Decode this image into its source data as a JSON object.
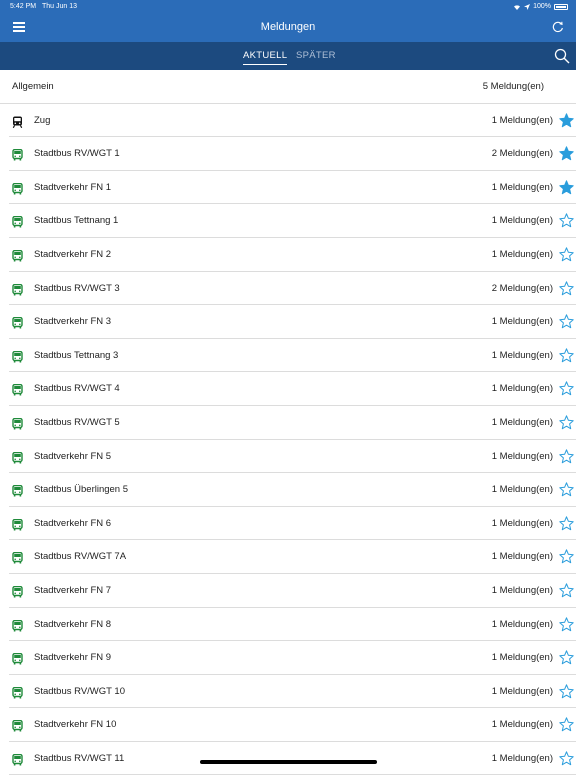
{
  "status_bar": {
    "time": "5:42 PM",
    "date": "Thu Jun 13",
    "battery": "100%"
  },
  "header": {
    "title": "Meldungen"
  },
  "tabs": [
    {
      "label": "AKTUELL",
      "active": true
    },
    {
      "label": "SPÄTER",
      "active": false
    }
  ],
  "general": {
    "label": "Allgemein",
    "count": "5 Meldung(en)"
  },
  "colors": {
    "nav": "#2b6cb8",
    "tabbar": "#1c4a7f",
    "bus": "#1f8a3a",
    "star": "#2a9ddc"
  },
  "items": [
    {
      "label": "Zug",
      "count": "1 Meldung(en)",
      "icon": "train-icon",
      "favorite": true
    },
    {
      "label": "Stadtbus RV/WGT 1",
      "count": "2 Meldung(en)",
      "icon": "bus-icon",
      "favorite": true
    },
    {
      "label": "Stadtverkehr FN 1",
      "count": "1 Meldung(en)",
      "icon": "bus-icon",
      "favorite": true
    },
    {
      "label": "Stadtbus Tettnang 1",
      "count": "1 Meldung(en)",
      "icon": "bus-icon",
      "favorite": false
    },
    {
      "label": "Stadtverkehr FN 2",
      "count": "1 Meldung(en)",
      "icon": "bus-icon",
      "favorite": false
    },
    {
      "label": "Stadtbus RV/WGT 3",
      "count": "2 Meldung(en)",
      "icon": "bus-icon",
      "favorite": false
    },
    {
      "label": "Stadtverkehr FN 3",
      "count": "1 Meldung(en)",
      "icon": "bus-icon",
      "favorite": false
    },
    {
      "label": "Stadtbus Tettnang 3",
      "count": "1 Meldung(en)",
      "icon": "bus-icon",
      "favorite": false
    },
    {
      "label": "Stadtbus RV/WGT 4",
      "count": "1 Meldung(en)",
      "icon": "bus-icon",
      "favorite": false
    },
    {
      "label": "Stadtbus RV/WGT 5",
      "count": "1 Meldung(en)",
      "icon": "bus-icon",
      "favorite": false
    },
    {
      "label": "Stadtverkehr FN 5",
      "count": "1 Meldung(en)",
      "icon": "bus-icon",
      "favorite": false
    },
    {
      "label": "Stadtbus Überlingen 5",
      "count": "1 Meldung(en)",
      "icon": "bus-icon",
      "favorite": false
    },
    {
      "label": "Stadtverkehr FN 6",
      "count": "1 Meldung(en)",
      "icon": "bus-icon",
      "favorite": false
    },
    {
      "label": "Stadtbus RV/WGT 7A",
      "count": "1 Meldung(en)",
      "icon": "bus-icon",
      "favorite": false
    },
    {
      "label": "Stadtverkehr FN 7",
      "count": "1 Meldung(en)",
      "icon": "bus-icon",
      "favorite": false
    },
    {
      "label": "Stadtverkehr FN 8",
      "count": "1 Meldung(en)",
      "icon": "bus-icon",
      "favorite": false
    },
    {
      "label": "Stadtverkehr FN 9",
      "count": "1 Meldung(en)",
      "icon": "bus-icon",
      "favorite": false
    },
    {
      "label": "Stadtbus RV/WGT 10",
      "count": "1 Meldung(en)",
      "icon": "bus-icon",
      "favorite": false
    },
    {
      "label": "Stadtverkehr FN 10",
      "count": "1 Meldung(en)",
      "icon": "bus-icon",
      "favorite": false
    },
    {
      "label": "Stadtbus RV/WGT 11",
      "count": "1 Meldung(en)",
      "icon": "bus-icon",
      "favorite": false
    }
  ]
}
